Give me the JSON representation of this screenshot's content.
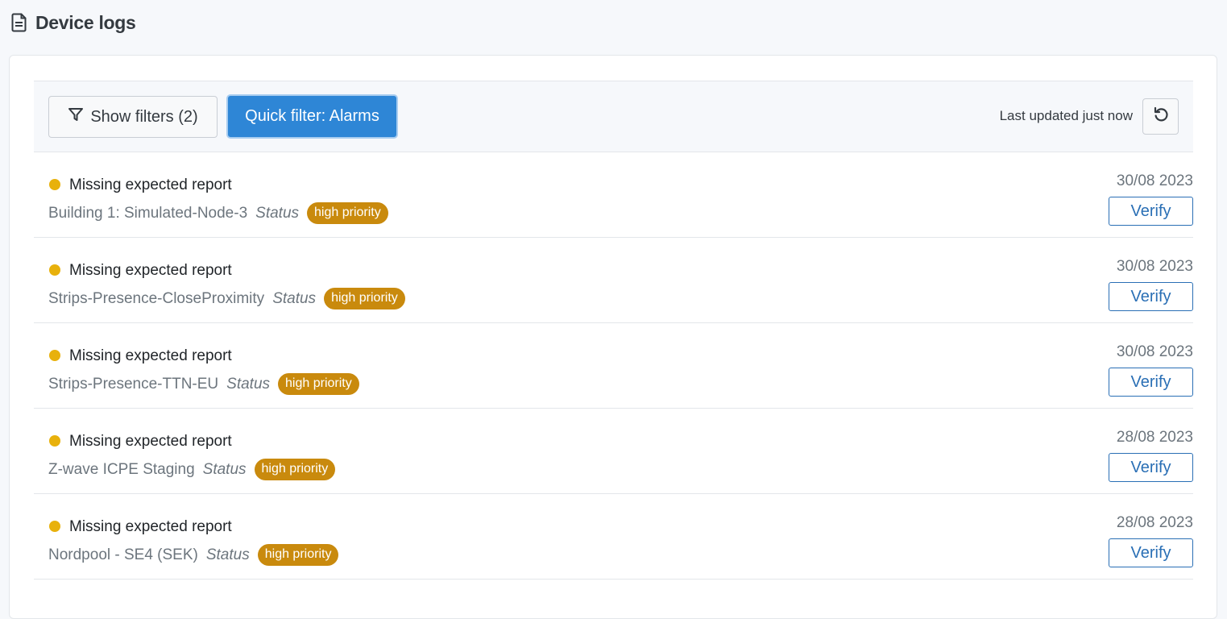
{
  "page": {
    "title": "Device logs",
    "icon": "document-icon"
  },
  "toolbar": {
    "show_filters_label": "Show filters (2)",
    "filter_icon": "filter-icon",
    "quick_filter_label": "Quick filter: Alarms",
    "last_updated": "Last updated just now",
    "refresh_icon": "refresh-icon"
  },
  "colors": {
    "accent": "#2e86d6",
    "warning_dot": "#e8b10c",
    "priority_badge": "#c98a0d",
    "verify_text": "#2a6fb5"
  },
  "logs": [
    {
      "title": "Missing expected report",
      "device": "Building 1: Simulated-Node-3",
      "status_label": "Status",
      "badge": "high priority",
      "date": "30/08 2023",
      "action": "Verify"
    },
    {
      "title": "Missing expected report",
      "device": "Strips-Presence-CloseProximity",
      "status_label": "Status",
      "badge": "high priority",
      "date": "30/08 2023",
      "action": "Verify"
    },
    {
      "title": "Missing expected report",
      "device": "Strips-Presence-TTN-EU",
      "status_label": "Status",
      "badge": "high priority",
      "date": "30/08 2023",
      "action": "Verify"
    },
    {
      "title": "Missing expected report",
      "device": "Z-wave ICPE Staging",
      "status_label": "Status",
      "badge": "high priority",
      "date": "28/08 2023",
      "action": "Verify"
    },
    {
      "title": "Missing expected report",
      "device": "Nordpool - SE4 (SEK)",
      "status_label": "Status",
      "badge": "high priority",
      "date": "28/08 2023",
      "action": "Verify"
    }
  ]
}
